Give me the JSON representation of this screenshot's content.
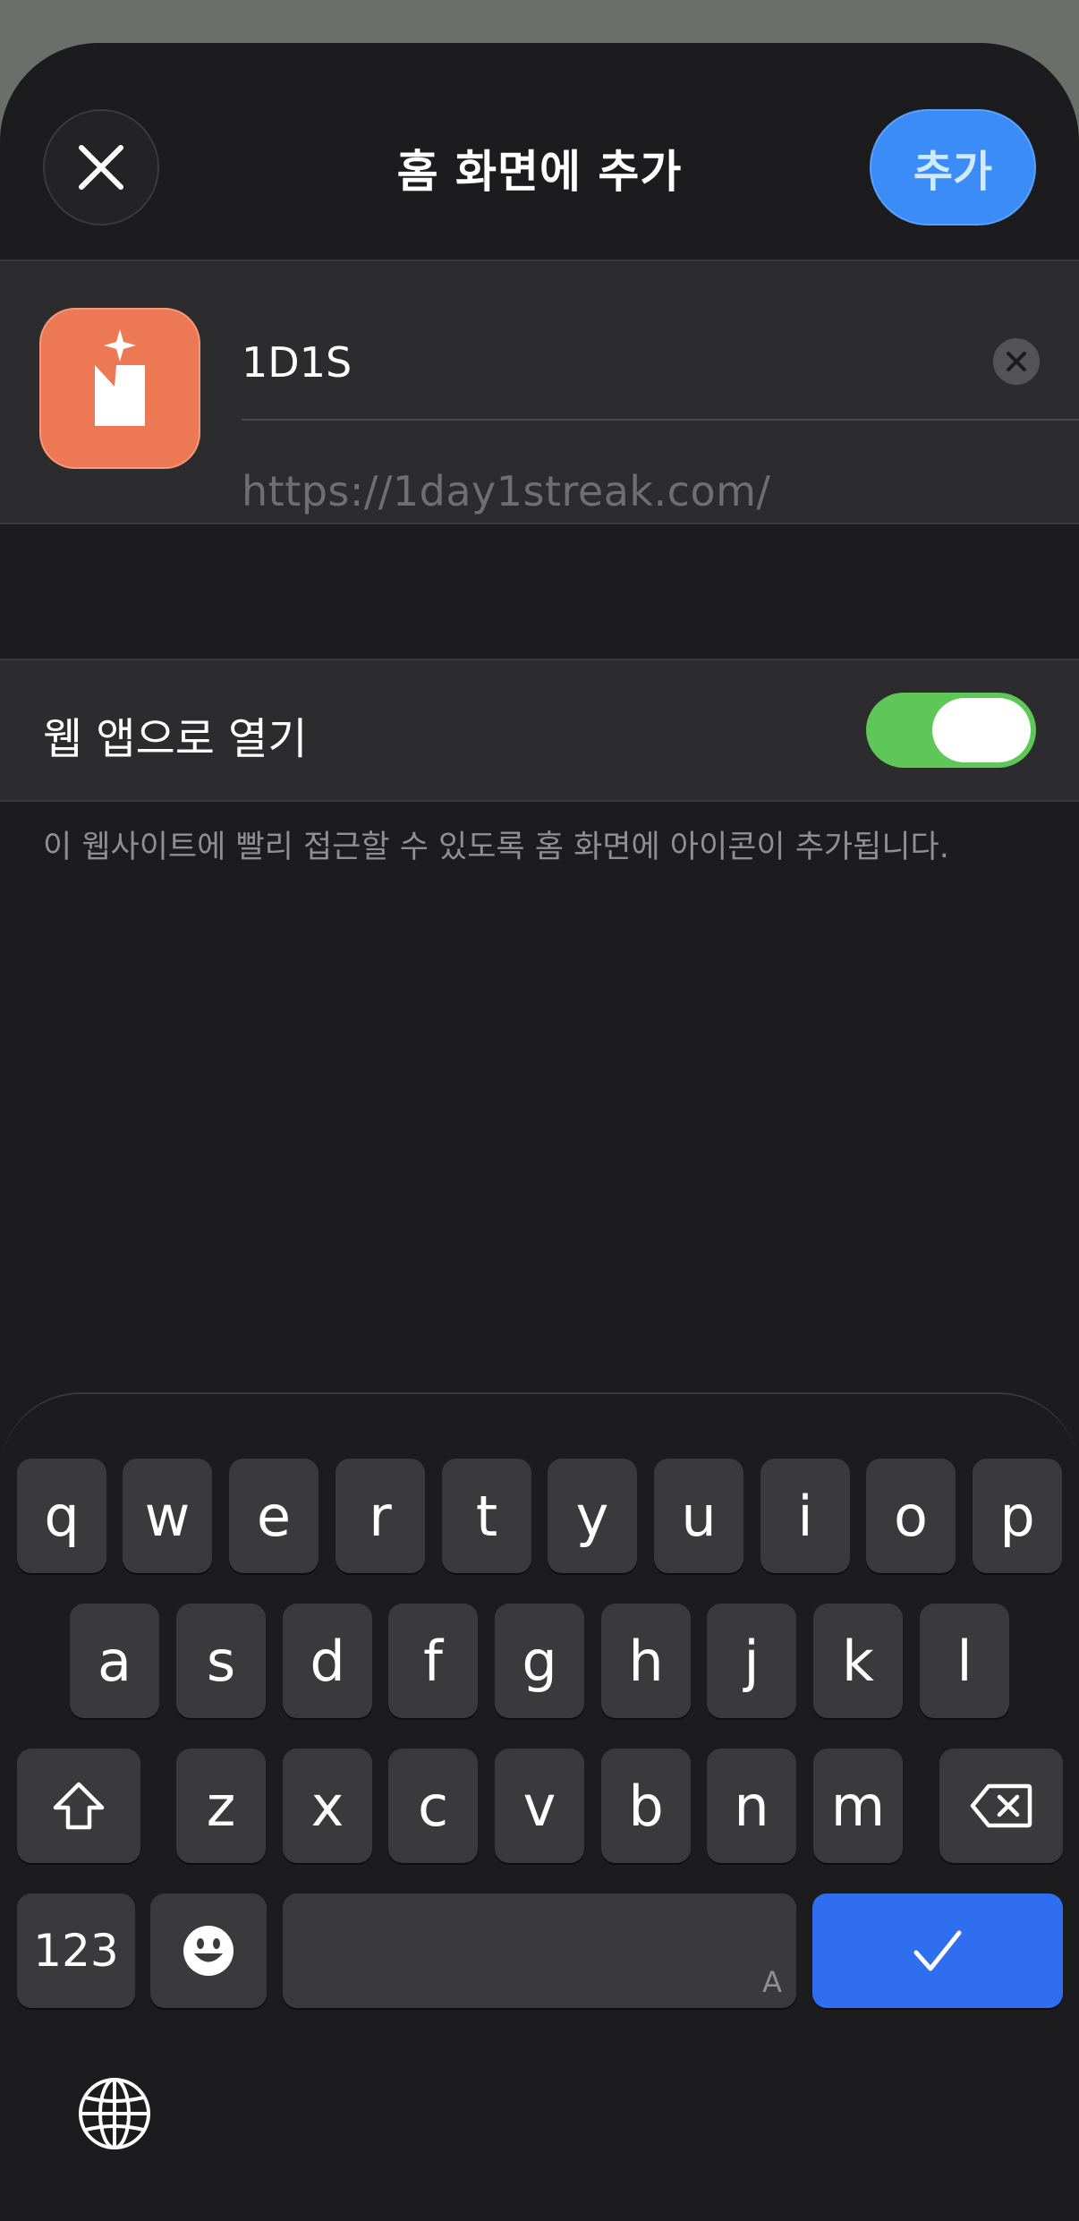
{
  "header": {
    "title": "홈 화면에 추가",
    "close_icon": "close-icon",
    "add_label": "추가",
    "accent_color": "#3b8cf6"
  },
  "bookmark": {
    "name_value": "1D1S",
    "url": "https://1day1streak.com/",
    "icon_color": "#ed7954",
    "clear_icon": "clear-circle-icon"
  },
  "web_app": {
    "label": "웹 앱으로 열기",
    "toggle_on": true,
    "toggle_color": "#5fc758"
  },
  "footnote": "이 웹사이트에 빨리 접근할 수 있도록 홈 화면에 아이콘이 추가됩니다.",
  "keyboard": {
    "row1": [
      "q",
      "w",
      "e",
      "r",
      "t",
      "y",
      "u",
      "i",
      "o",
      "p"
    ],
    "row2": [
      "a",
      "s",
      "d",
      "f",
      "g",
      "h",
      "j",
      "k",
      "l"
    ],
    "row3": [
      "z",
      "x",
      "c",
      "v",
      "b",
      "n",
      "m"
    ],
    "numbers_label": "123",
    "space_hint": "A",
    "shift_icon": "shift-icon",
    "delete_icon": "delete-icon",
    "emoji_icon": "emoji-icon",
    "return_icon": "checkmark-icon",
    "globe_icon": "globe-icon"
  }
}
